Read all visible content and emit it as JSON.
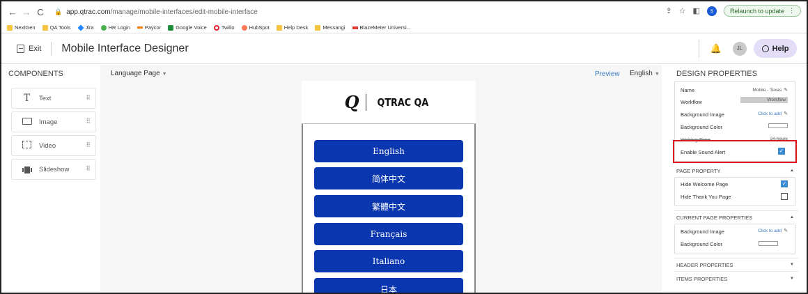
{
  "browser": {
    "url_host": "app.qtrac.com",
    "url_path": "/manage/mobile-interfaces/edit-mobile-interface",
    "profile_initial": "s",
    "relaunch_label": "Relaunch to update"
  },
  "bookmarks": [
    {
      "label": "NextGen",
      "icon": "folder-icon"
    },
    {
      "label": "QA Tools",
      "icon": "folder-icon"
    },
    {
      "label": "Jira",
      "icon": "jira-icon"
    },
    {
      "label": "HR Login",
      "icon": "hr-icon"
    },
    {
      "label": "Paycor",
      "icon": "paycor-icon"
    },
    {
      "label": "Google Voice",
      "icon": "phone-icon"
    },
    {
      "label": "Twilio",
      "icon": "twilio-icon"
    },
    {
      "label": "HubSpot",
      "icon": "hubspot-icon"
    },
    {
      "label": "Help Desk",
      "icon": "folder-icon"
    },
    {
      "label": "Messangi",
      "icon": "folder-icon"
    },
    {
      "label": "BlazeMeter Universi...",
      "icon": "blazemeter-icon"
    }
  ],
  "header": {
    "exit_label": "Exit",
    "title": "Mobile Interface Designer",
    "avatar_initials": "JL",
    "help_label": "Help"
  },
  "components": {
    "title": "COMPONENTS",
    "items": [
      {
        "label": "Text",
        "icon": "text-icon"
      },
      {
        "label": "Image",
        "icon": "image-icon"
      },
      {
        "label": "Video",
        "icon": "video-icon"
      },
      {
        "label": "Slideshow",
        "icon": "slideshow-icon"
      }
    ]
  },
  "canvas": {
    "page_select": "Language Page",
    "preview_label": "Preview",
    "language_select": "English",
    "logo_text": "QTRAC QA",
    "buttons": [
      "English",
      "简体中文",
      "繁體中文",
      "Français",
      "Italiano",
      "日本"
    ]
  },
  "design_properties": {
    "title": "DESIGN PROPERTIES",
    "name_label": "Name",
    "name_value": "Mobile - Texas",
    "workflow_label": "Workflow",
    "workflow_value": "Workflow",
    "bg_image_label": "Background Image",
    "bg_image_value": "Click to add",
    "bg_color_label": "Background Color",
    "waiting_time_label": "Waiting Time",
    "waiting_time_value": "24 hours",
    "sound_alert_label": "Enable Sound Alert",
    "sound_alert_checked": true
  },
  "page_property": {
    "title": "PAGE PROPERTY",
    "hide_welcome_label": "Hide Welcome Page",
    "hide_welcome_checked": true,
    "hide_thankyou_label": "Hide Thank You Page",
    "hide_thankyou_checked": false
  },
  "current_page_properties": {
    "title": "CURRENT PAGE PROPERTIES",
    "bg_image_label": "Background Image",
    "bg_image_value": "Click to add",
    "bg_color_label": "Background Color"
  },
  "header_properties": {
    "title": "HEADER PROPERTIES"
  },
  "items_properties": {
    "title": "ITEMS PROPERTIES"
  },
  "colors": {
    "button_blue": "#0a36b0",
    "accent": "#3a7fc4",
    "highlight": "#e0141e"
  }
}
